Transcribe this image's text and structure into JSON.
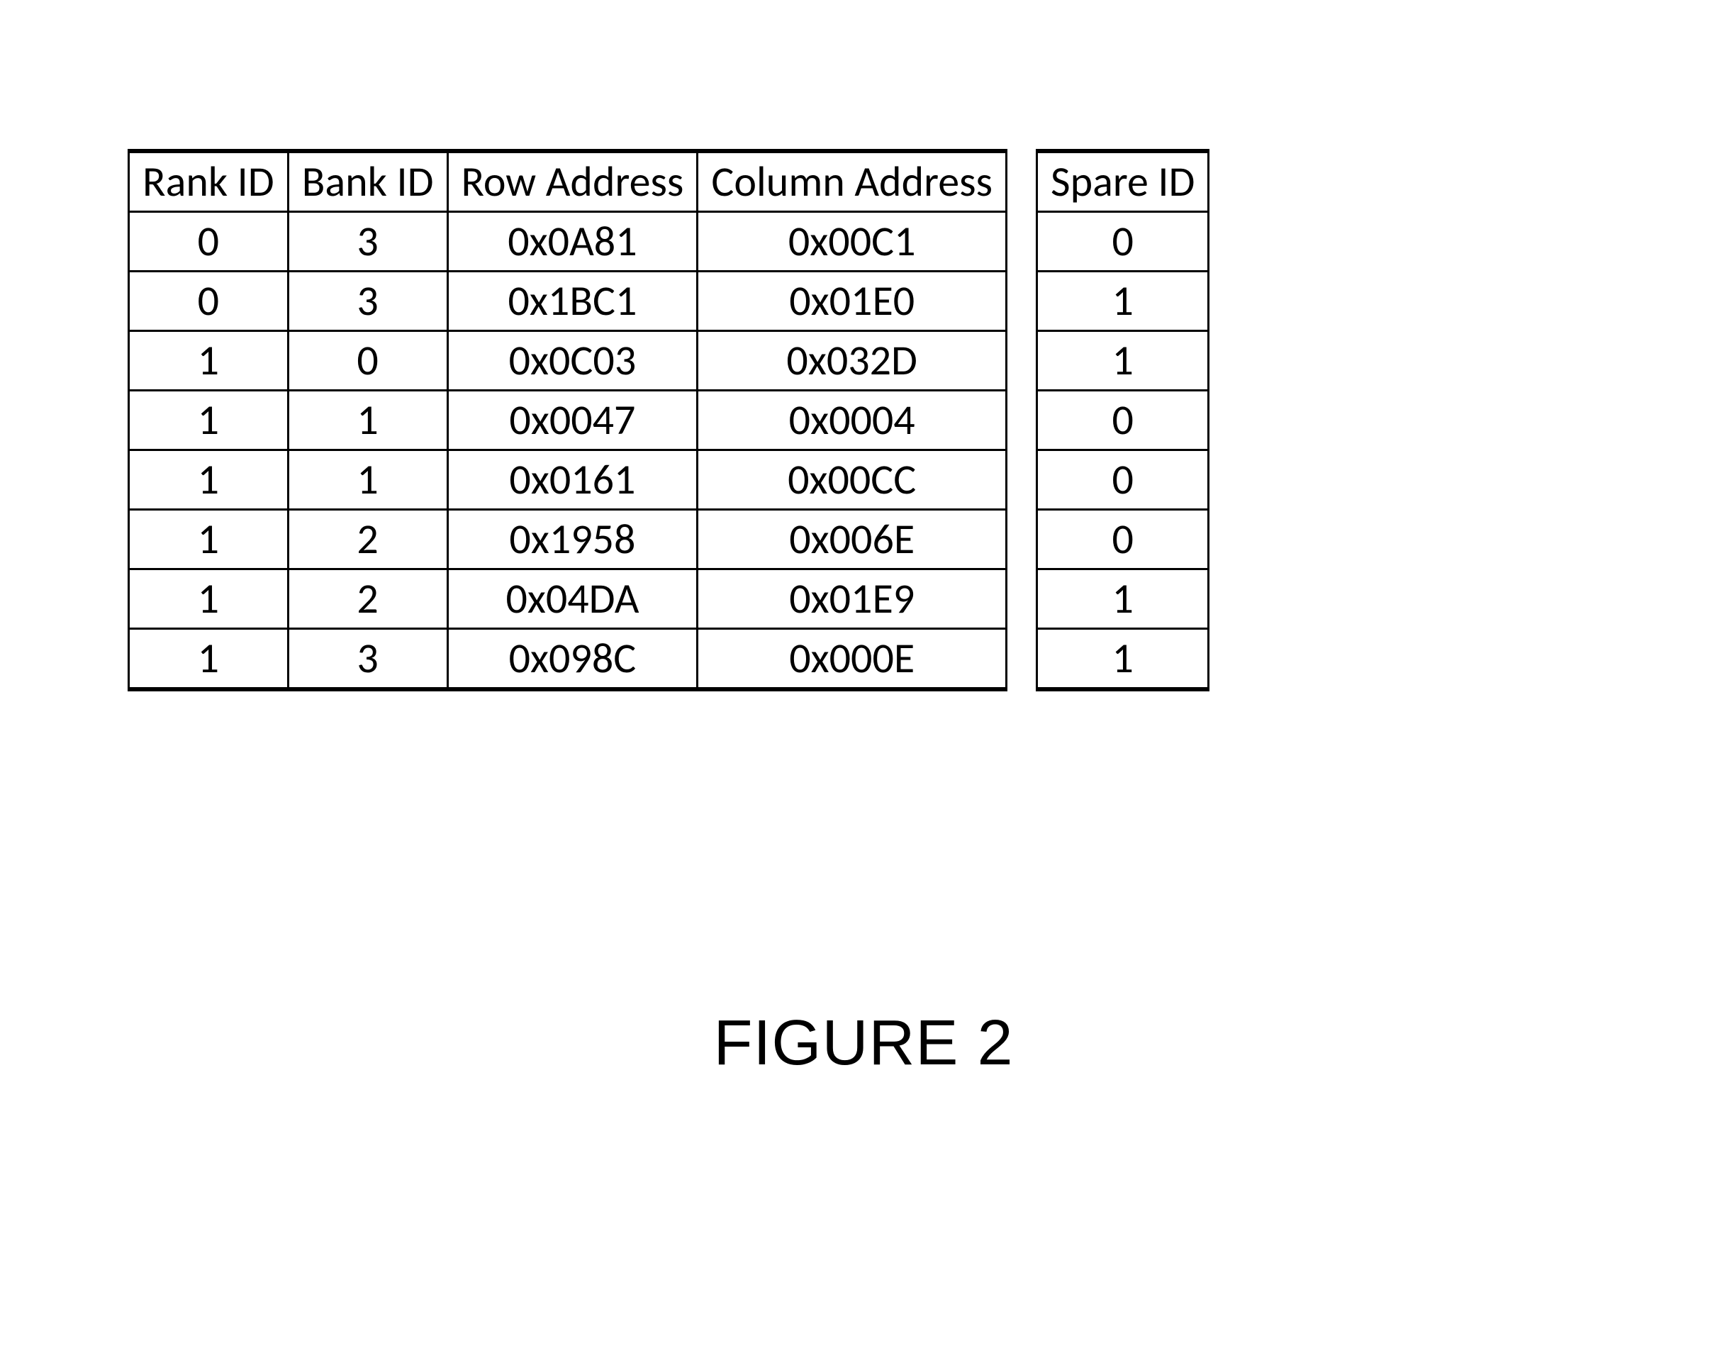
{
  "table": {
    "headers": {
      "rank_id": "Rank ID",
      "bank_id": "Bank ID",
      "row_address": "Row Address",
      "column_address": "Column Address",
      "spare_id": "Spare ID"
    },
    "rows": [
      {
        "rank_id": "0",
        "bank_id": "3",
        "row_address": "0x0A81",
        "column_address": "0x00C1",
        "spare_id": "0"
      },
      {
        "rank_id": "0",
        "bank_id": "3",
        "row_address": "0x1BC1",
        "column_address": "0x01E0",
        "spare_id": "1"
      },
      {
        "rank_id": "1",
        "bank_id": "0",
        "row_address": "0x0C03",
        "column_address": "0x032D",
        "spare_id": "1"
      },
      {
        "rank_id": "1",
        "bank_id": "1",
        "row_address": "0x0047",
        "column_address": "0x0004",
        "spare_id": "0"
      },
      {
        "rank_id": "1",
        "bank_id": "1",
        "row_address": "0x0161",
        "column_address": "0x00CC",
        "spare_id": "0"
      },
      {
        "rank_id": "1",
        "bank_id": "2",
        "row_address": "0x1958",
        "column_address": "0x006E",
        "spare_id": "0"
      },
      {
        "rank_id": "1",
        "bank_id": "2",
        "row_address": "0x04DA",
        "column_address": "0x01E9",
        "spare_id": "1"
      },
      {
        "rank_id": "1",
        "bank_id": "3",
        "row_address": "0x098C",
        "column_address": "0x000E",
        "spare_id": "1"
      }
    ]
  },
  "caption": "FIGURE 2"
}
